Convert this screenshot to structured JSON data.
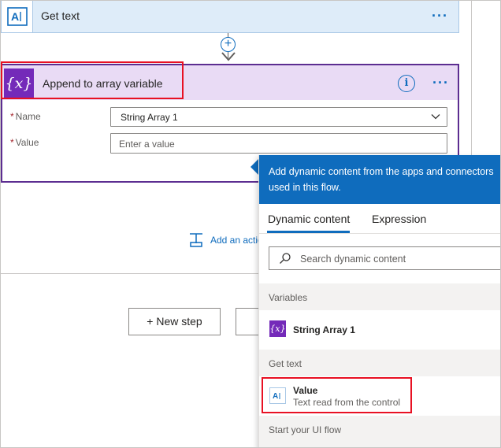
{
  "get_text_step": {
    "title": "Get text",
    "more": "···"
  },
  "append_step": {
    "icon_text": "{x}",
    "title": "Append to array variable",
    "more": "···",
    "info": "i",
    "name_label": "Name",
    "name_value": "String Array 1",
    "value_label": "Value",
    "value_placeholder": "Enter a value"
  },
  "canvas": {
    "add_action": "Add an action",
    "new_step": "+ New step"
  },
  "dynamic_panel": {
    "header": "Add dynamic content from the apps and connectors used in this flow.",
    "tabs": [
      "Dynamic content",
      "Expression"
    ],
    "search_placeholder": "Search dynamic content",
    "groups": {
      "variables": "Variables",
      "get_text": "Get text",
      "start": "Start your UI flow"
    },
    "items": {
      "string_array": {
        "icon": "{x}",
        "label": "String Array 1"
      },
      "value": {
        "label": "Value",
        "sub": "Text read from the control"
      }
    }
  },
  "colors": {
    "accent": "#0f6cbd",
    "variable_purple": "#742ab9",
    "highlight_red": "#e81123"
  },
  "icons": {
    "get_text": "text-box-icon",
    "variable": "curly-x-icon",
    "info": "info-icon",
    "search": "search-icon",
    "add_action": "add-action-icon",
    "chevron": "chevron-down-icon",
    "plus": "plus-circle-icon"
  }
}
